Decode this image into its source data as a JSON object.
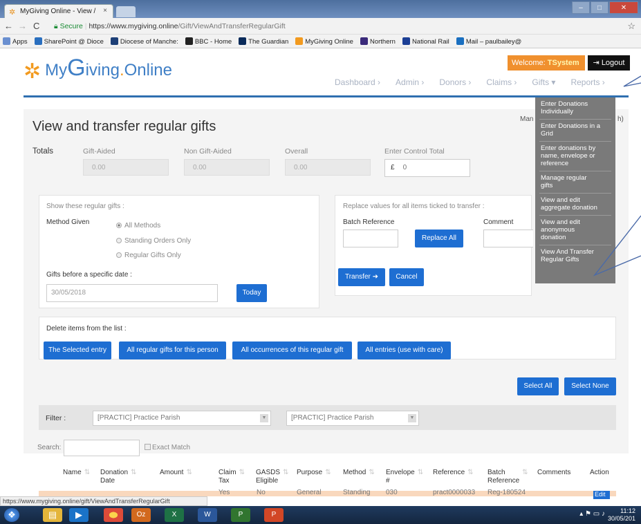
{
  "browser": {
    "tab_title": "MyGiving Online - View /",
    "tab_close": "×",
    "url_secure": "Secure",
    "url_base": "https://www.mygiving.online",
    "url_path": "/Gift/ViewAndTransferRegularGift",
    "bookmarks": [
      {
        "label": "Apps",
        "color": "#6a8fd0"
      },
      {
        "label": "SharePoint @ Dioce",
        "color": "#2a6fbf"
      },
      {
        "label": "Diocese of Manche:",
        "color": "#1d3f77"
      },
      {
        "label": "BBC - Home",
        "color": "#222222"
      },
      {
        "label": "The Guardian",
        "color": "#0a2b5a"
      },
      {
        "label": "MyGiving Online",
        "color": "#f29a1f"
      },
      {
        "label": "Northern",
        "color": "#3a2a7a"
      },
      {
        "label": "National Rail",
        "color": "#1c3f95"
      },
      {
        "label": "Mail – paulbailey@",
        "color": "#1a6fc0"
      }
    ],
    "status_url": "https://www.mygiving.online/gift/ViewAndTransferRegularGift"
  },
  "header": {
    "logo_my": "My",
    "logo_g": "G",
    "logo_iving": "iving",
    "logo_dot": ".",
    "logo_online": "Online",
    "welcome_prefix": "Welcome:",
    "welcome_user": "TSystem",
    "logout_label": "Logout",
    "nav": [
      "Dashboard ›",
      "Admin ›",
      "Donors ›",
      "Claims ›",
      "Gifts ▾",
      "Reports ›"
    ]
  },
  "page": {
    "managed_text": "Man",
    "managed_tail": "h)",
    "title": "View and transfer regular gifts",
    "totals_label": "Totals",
    "gift_aided_label": "Gift-Aided",
    "gift_aided_value": "0.00",
    "non_gift_aided_label": "Non Gift-Aided",
    "non_gift_aided_value": "0.00",
    "overall_label": "Overall",
    "overall_value": "0.00",
    "control_total_label": "Enter Control Total",
    "control_total_currency": "£",
    "control_total_value": "0"
  },
  "filter": {
    "show_label": "Show these regular gifts :",
    "method_label": "Method Given",
    "methods": [
      "All Methods",
      "Standing Orders Only",
      "Regular Gifts Only"
    ],
    "date_label": "Gifts before a specific date :",
    "date_value": "30/05/2018",
    "today_button": "Today"
  },
  "replace": {
    "heading": "Replace values for all items ticked to transfer :",
    "batch_ref_label": "Batch Reference",
    "comment_label": "Comment",
    "replace_all_button": "Replace All",
    "transfer_button": "Transfer",
    "cancel_button": "Cancel"
  },
  "delete": {
    "label": "Delete items from the list :",
    "buttons": [
      "The Selected entry",
      "All regular gifts for this person",
      "All occurrences of this regular gift",
      "All entries (use with care)"
    ]
  },
  "selection": {
    "select_all": "Select All",
    "select_none": "Select None"
  },
  "table_filter": {
    "filter_label": "Filter :",
    "select1": "[PRACTIC] Practice Parish",
    "select2": "[PRACTIC] Practice Parish",
    "search_label": "Search:",
    "exact_match": "Exact Match"
  },
  "table": {
    "headers": [
      [
        "Name"
      ],
      [
        "Donation",
        "Date"
      ],
      [
        "Amount"
      ],
      [
        "Claim",
        "Tax"
      ],
      [
        "GASDS",
        "Eligible"
      ],
      [
        "Purpose"
      ],
      [
        "Method"
      ],
      [
        "Envelope",
        "#"
      ],
      [
        "Reference"
      ],
      [
        "Batch",
        "Reference"
      ],
      [
        "Comments"
      ],
      [
        "Action"
      ]
    ],
    "row": {
      "claim_tax": "Yes",
      "gasds": "No",
      "purpose": "General",
      "method": "Standing",
      "envelope": "030",
      "reference": "pract0000033",
      "batch": "Reg-180524",
      "action": "Edit"
    }
  },
  "gifts_menu": [
    [
      "Enter Donations",
      "Individually"
    ],
    [
      "Enter Donations in a",
      "Grid"
    ],
    [
      "Enter donations by",
      "name, envelope or",
      "reference"
    ],
    [
      "Manage regular",
      "gifts"
    ],
    [
      "View and edit",
      "aggregate donation"
    ],
    [
      "View and edit",
      "anonymous",
      "donation"
    ],
    [
      "View And Transfer",
      "Regular Gifts"
    ]
  ],
  "taskbar": {
    "time": "11:12",
    "date": "30/05/201"
  },
  "colors": {
    "accent": "#1e6ed2",
    "nav_line": "#2f6fb0",
    "welcome": "#f0902e",
    "logo_star": "#f29a1f"
  }
}
